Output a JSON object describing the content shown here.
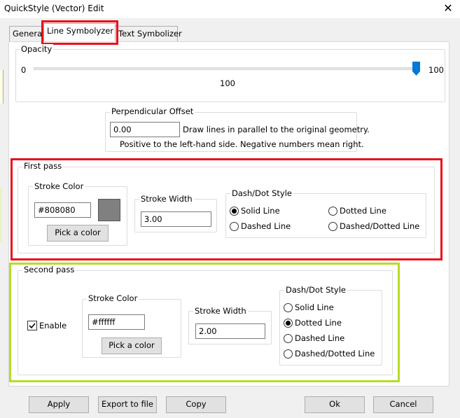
{
  "window": {
    "title": "QuickStyle (Vector) Edit",
    "close_glyph": "✕"
  },
  "tabs": [
    {
      "label": "General"
    },
    {
      "label": "Line Symbolyzer"
    },
    {
      "label": "Text Symbolizer"
    }
  ],
  "opacity": {
    "legend": "Opacity",
    "min_label": "0",
    "max_label": "100",
    "value_label": "100",
    "value": 100
  },
  "offset": {
    "legend": "Perpendicular Offset",
    "value": "0.00",
    "hint1": "Draw lines in parallel to the original geometry.",
    "hint2": "Positive to the left-hand side. Negative numbers mean right."
  },
  "first_pass": {
    "legend": "First pass",
    "stroke_color_legend": "Stroke Color",
    "color_value": "#808080",
    "swatch_color": "#808080",
    "pick_label": "Pick a color",
    "stroke_width_legend": "Stroke Width",
    "width_value": "3.00",
    "dash_legend": "Dash/Dot Style",
    "styles": {
      "solid": "Solid Line",
      "dotted": "Dotted Line",
      "dashed": "Dashed Line",
      "dashdot": "Dashed/Dotted Line"
    },
    "selected": "Solid Line"
  },
  "second_pass": {
    "legend": "Second pass",
    "enable_label": "Enable",
    "enabled": true,
    "stroke_color_legend": "Stroke Color",
    "color_value": "#ffffff",
    "pick_label": "Pick a color",
    "stroke_width_legend": "Stroke Width",
    "width_value": "2.00",
    "dash_legend": "Dash/Dot Style",
    "styles": {
      "solid": "Solid Line",
      "dotted": "Dotted Line",
      "dashed": "Dashed Line",
      "dashdot": "Dashed/Dotted Line"
    },
    "selected": "Dotted Line"
  },
  "buttons": {
    "apply": "Apply",
    "export": "Export to file",
    "copy": "Copy",
    "ok": "Ok",
    "cancel": "Cancel"
  },
  "colors": {
    "highlight_red": "#e8101a",
    "highlight_green": "#b6dc27",
    "slider_thumb": "#0078d7"
  }
}
